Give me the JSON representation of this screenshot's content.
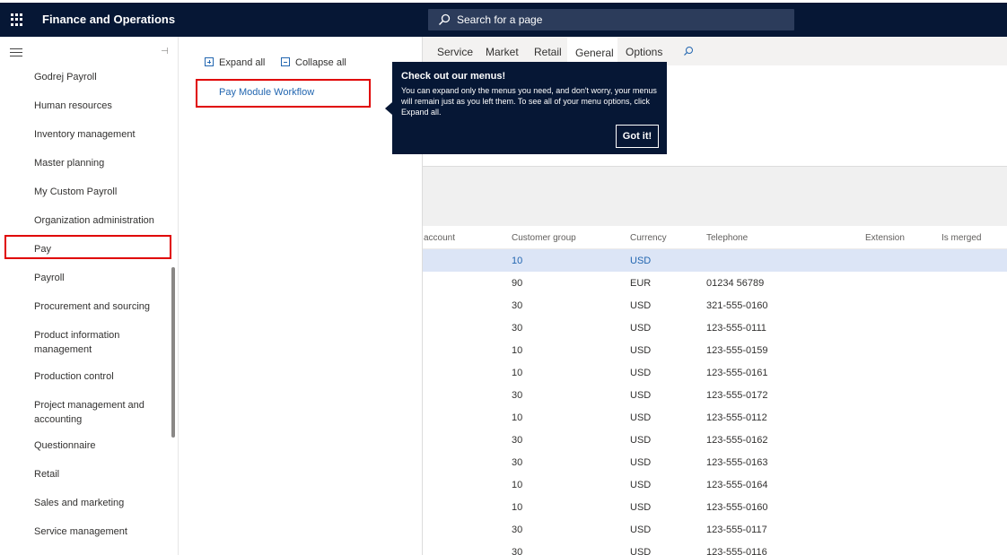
{
  "app": {
    "title": "Finance and Operations"
  },
  "search": {
    "placeholder": "Search for a page"
  },
  "nav": {
    "items": [
      {
        "label": "Godrej Payroll"
      },
      {
        "label": "Human resources"
      },
      {
        "label": "Inventory management"
      },
      {
        "label": "Master planning"
      },
      {
        "label": "My Custom Payroll"
      },
      {
        "label": "Organization administration"
      },
      {
        "label": "Pay",
        "selected": true
      },
      {
        "label": "Payroll"
      },
      {
        "label": "Procurement and sourcing"
      },
      {
        "label": "Product information management"
      },
      {
        "label": "Production control"
      },
      {
        "label": "Project management and accounting"
      },
      {
        "label": "Questionnaire"
      },
      {
        "label": "Retail"
      },
      {
        "label": "Sales and marketing"
      },
      {
        "label": "Service management"
      }
    ]
  },
  "flyout": {
    "expand_all": "Expand all",
    "collapse_all": "Collapse all",
    "link": "Pay Module Workflow"
  },
  "tabs": [
    "Service",
    "Market",
    "Retail",
    "General",
    "Options"
  ],
  "active_tab": "General",
  "teaching_bubble": {
    "title": "Check out our menus!",
    "text": "You can expand only the menus you need, and don't worry, your menus will remain just as you left them. To see all of your menu options, click Expand all.",
    "button": "Got it!"
  },
  "grid": {
    "headers": [
      "account",
      "Customer group",
      "Currency",
      "Telephone",
      "Extension",
      "Is merged"
    ],
    "rows": [
      {
        "group": "10",
        "currency": "USD",
        "phone": ""
      },
      {
        "group": "90",
        "currency": "EUR",
        "phone": "01234 56789"
      },
      {
        "group": "30",
        "currency": "USD",
        "phone": "321-555-0160"
      },
      {
        "group": "30",
        "currency": "USD",
        "phone": "123-555-0111"
      },
      {
        "group": "10",
        "currency": "USD",
        "phone": "123-555-0159"
      },
      {
        "group": "10",
        "currency": "USD",
        "phone": "123-555-0161"
      },
      {
        "group": "30",
        "currency": "USD",
        "phone": "123-555-0172"
      },
      {
        "group": "10",
        "currency": "USD",
        "phone": "123-555-0112"
      },
      {
        "group": "30",
        "currency": "USD",
        "phone": "123-555-0162"
      },
      {
        "group": "30",
        "currency": "USD",
        "phone": "123-555-0163"
      },
      {
        "group": "10",
        "currency": "USD",
        "phone": "123-555-0164"
      },
      {
        "group": "10",
        "currency": "USD",
        "phone": "123-555-0160"
      },
      {
        "group": "30",
        "currency": "USD",
        "phone": "123-555-0117"
      },
      {
        "group": "30",
        "currency": "USD",
        "phone": "123-555-0116"
      }
    ]
  },
  "colors": {
    "topbar": "#061735",
    "accent": "#2266b0",
    "highlight_box": "#e00000",
    "selected_row": "#dce5f6"
  }
}
